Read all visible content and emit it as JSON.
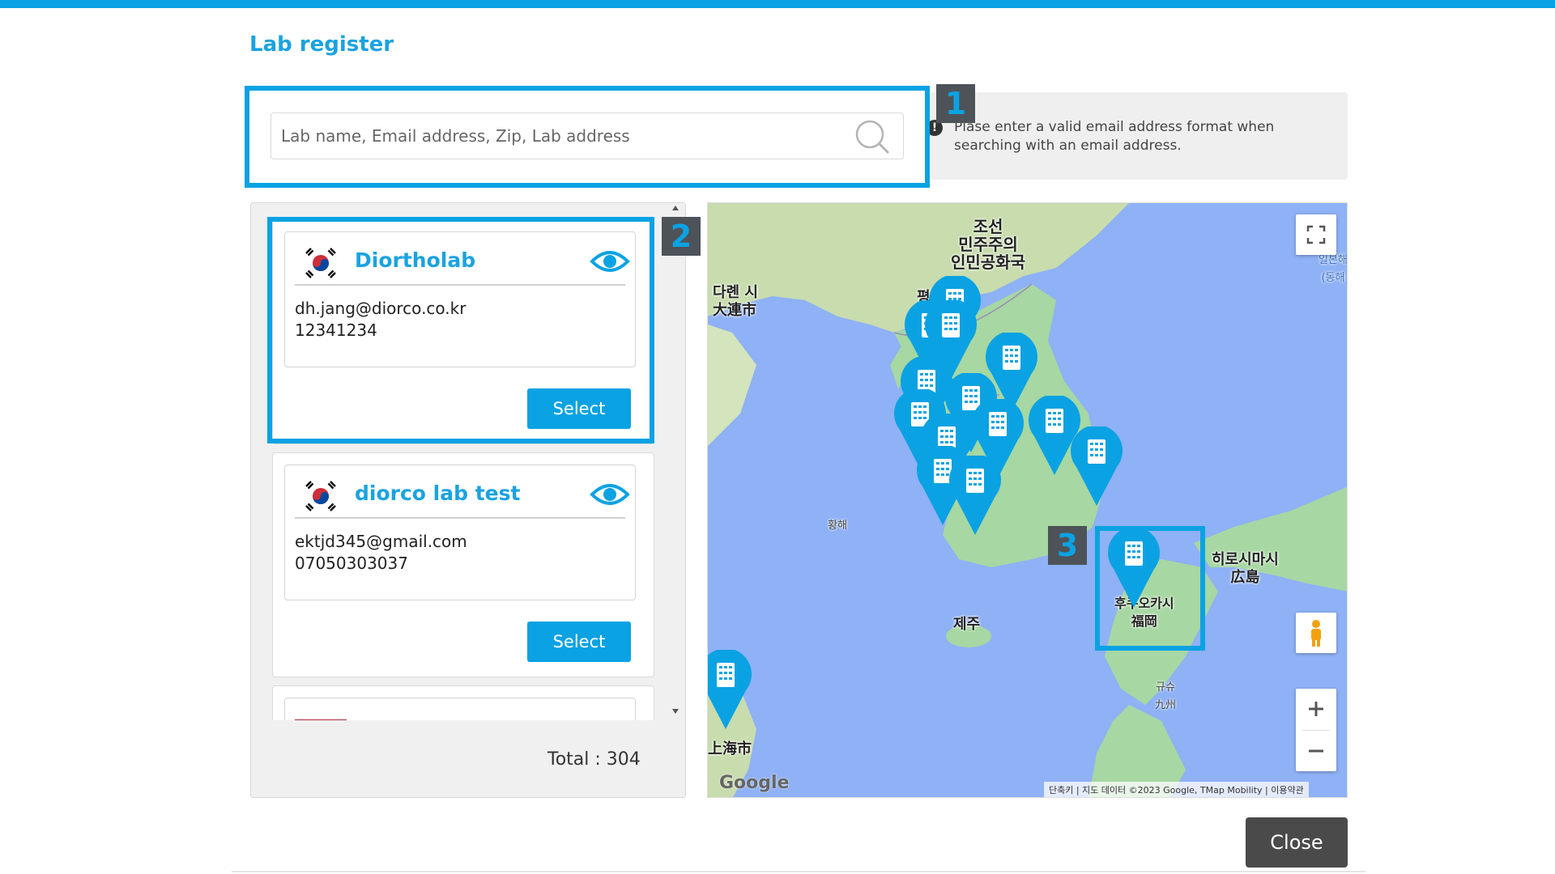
{
  "dialog": {
    "title": "Lab register"
  },
  "search": {
    "placeholder": "Lab name, Email address, Zip, Lab address",
    "value": "",
    "tip": "Plase enter a valid email address format when searching with an email address.",
    "tip_icon": "exclamation-icon"
  },
  "callouts": [
    "1",
    "2",
    "3"
  ],
  "labs": [
    {
      "name": "Diortholab",
      "email": "dh.jang@diorco.co.kr",
      "phone": "12341234",
      "select_label": "Select",
      "flag": "korea-flag-icon"
    },
    {
      "name": "diorco lab test",
      "email": "ektjd345@gmail.com",
      "phone": "07050303037",
      "select_label": "Select",
      "flag": "korea-flag-icon"
    },
    {
      "name": "",
      "email": "",
      "phone": "",
      "select_label": "",
      "flag": "red-flag-icon"
    }
  ],
  "list": {
    "total_label": "Total : 304"
  },
  "map": {
    "labels": {
      "nk": "조선\n민주주의\n인민공화국",
      "dalian": "다롄 시\n大連市",
      "pyongyang": "평양",
      "yellow_sea": "황해",
      "jeju": "제주",
      "hiroshima": "히로시마시\n広島",
      "fukuoka": "후쿠오카시\n福岡",
      "kyushu": "규슈\n九州",
      "shanghai": "上海市",
      "japan": "일본해\n(동해"
    },
    "attribution": "단축키 | 지도 데이터 ©2023 Google, TMap Mobility | 이용약관",
    "logo": "Google"
  },
  "close_label": "Close",
  "accent": "#0aa2e3"
}
